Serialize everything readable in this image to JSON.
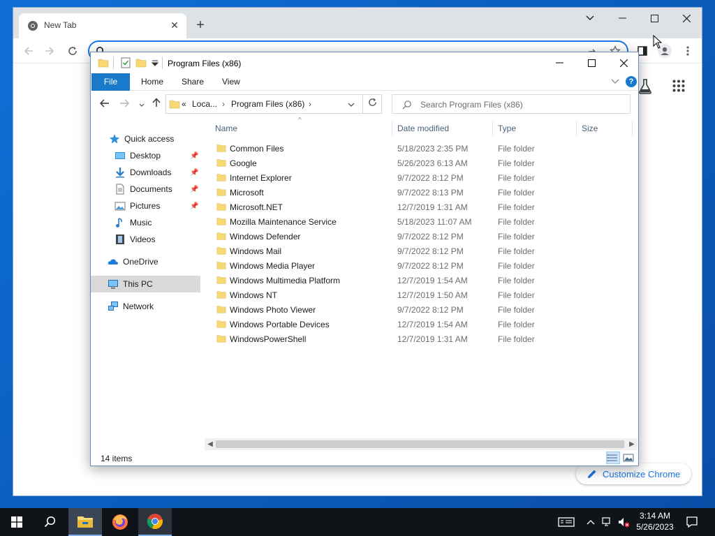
{
  "chrome": {
    "tab_title": "New Tab",
    "tab_close": "✕",
    "new_tab": "+",
    "omnibox_value": "",
    "customize_label": "Customize Chrome"
  },
  "explorer": {
    "window_title": "Program Files (x86)",
    "ribbon_tabs": [
      "File",
      "Home",
      "Share",
      "View"
    ],
    "address": {
      "chevrons": "«",
      "segment1": "Loca...",
      "segment2": "Program Files (x86)"
    },
    "search_placeholder": "Search Program Files (x86)",
    "nav_pane": {
      "quick_access": "Quick access",
      "desktop": "Desktop",
      "downloads": "Downloads",
      "documents": "Documents",
      "pictures": "Pictures",
      "music": "Music",
      "videos": "Videos",
      "onedrive": "OneDrive",
      "this_pc": "This PC",
      "network": "Network"
    },
    "columns": {
      "name": "Name",
      "date": "Date modified",
      "type": "Type",
      "size": "Size"
    },
    "files": [
      {
        "name": "Common Files",
        "date": "5/18/2023 2:35 PM",
        "type": "File folder"
      },
      {
        "name": "Google",
        "date": "5/26/2023 6:13 AM",
        "type": "File folder"
      },
      {
        "name": "Internet Explorer",
        "date": "9/7/2022 8:12 PM",
        "type": "File folder"
      },
      {
        "name": "Microsoft",
        "date": "9/7/2022 8:13 PM",
        "type": "File folder"
      },
      {
        "name": "Microsoft.NET",
        "date": "12/7/2019 1:31 AM",
        "type": "File folder"
      },
      {
        "name": "Mozilla Maintenance Service",
        "date": "5/18/2023 11:07 AM",
        "type": "File folder"
      },
      {
        "name": "Windows Defender",
        "date": "9/7/2022 8:12 PM",
        "type": "File folder"
      },
      {
        "name": "Windows Mail",
        "date": "9/7/2022 8:12 PM",
        "type": "File folder"
      },
      {
        "name": "Windows Media Player",
        "date": "9/7/2022 8:12 PM",
        "type": "File folder"
      },
      {
        "name": "Windows Multimedia Platform",
        "date": "12/7/2019 1:54 AM",
        "type": "File folder"
      },
      {
        "name": "Windows NT",
        "date": "12/7/2019 1:50 AM",
        "type": "File folder"
      },
      {
        "name": "Windows Photo Viewer",
        "date": "9/7/2022 8:12 PM",
        "type": "File folder"
      },
      {
        "name": "Windows Portable Devices",
        "date": "12/7/2019 1:54 AM",
        "type": "File folder"
      },
      {
        "name": "WindowsPowerShell",
        "date": "12/7/2019 1:31 AM",
        "type": "File folder"
      }
    ],
    "status_count": "14 items"
  },
  "taskbar": {
    "time": "3:14 AM",
    "date": "5/26/2023"
  },
  "colors": {
    "desktop": "#0a62c4",
    "file_tab": "#1979ca",
    "folder": "#f8d775",
    "chrome_accent": "#1a73e8"
  }
}
